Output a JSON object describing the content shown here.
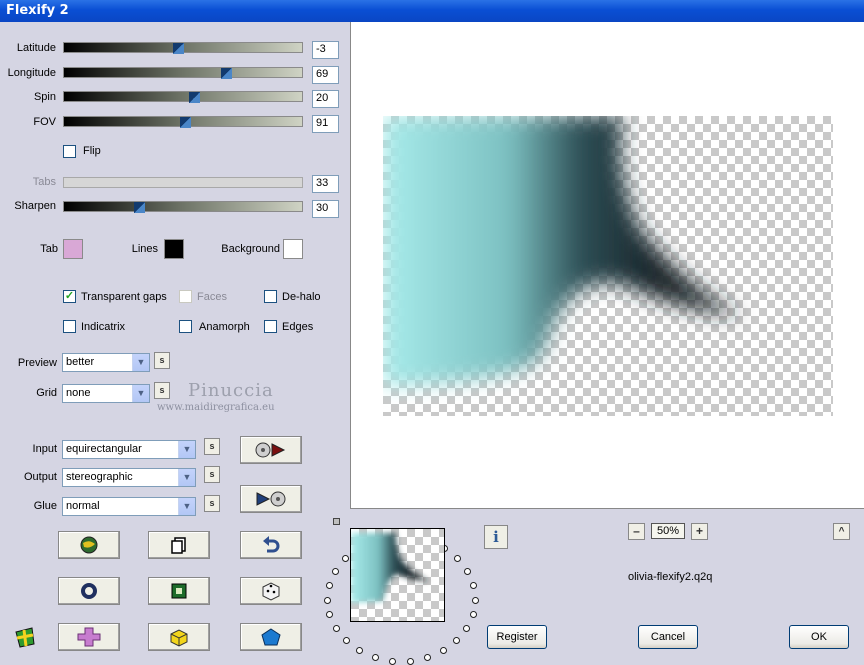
{
  "window": {
    "title": "Flexify 2"
  },
  "sliders": {
    "latitude": {
      "label": "Latitude",
      "value": "-3",
      "position": 0.48
    },
    "longitude": {
      "label": "Longitude",
      "value": "69",
      "position": 0.69
    },
    "spin": {
      "label": "Spin",
      "value": "20",
      "position": 0.55
    },
    "fov": {
      "label": "FOV",
      "value": "91",
      "position": 0.51
    },
    "tabs": {
      "label": "Tabs",
      "value": "33"
    },
    "sharpen": {
      "label": "Sharpen",
      "value": "30",
      "position": 0.31
    }
  },
  "flip": {
    "label": "Flip",
    "checked": false
  },
  "colors": {
    "tab": {
      "label": "Tab",
      "color": "#d9a8d6"
    },
    "lines": {
      "label": "Lines",
      "color": "#000000"
    },
    "background": {
      "label": "Background",
      "color": "#ffffff"
    }
  },
  "options": {
    "transparent_gaps": {
      "label": "Transparent gaps",
      "checked": true
    },
    "faces": {
      "label": "Faces",
      "checked": false
    },
    "dehalo": {
      "label": "De-halo",
      "checked": false
    },
    "indicatrix": {
      "label": "Indicatrix",
      "checked": false
    },
    "anamorph": {
      "label": "Anamorph",
      "checked": false
    },
    "edges": {
      "label": "Edges",
      "checked": false
    }
  },
  "dropdowns": {
    "preview": {
      "label": "Preview",
      "value": "better"
    },
    "grid": {
      "label": "Grid",
      "value": "none"
    },
    "input": {
      "label": "Input",
      "value": "equirectangular"
    },
    "output": {
      "label": "Output",
      "value": "stereographic"
    },
    "glue": {
      "label": "Glue",
      "value": "normal"
    }
  },
  "s_button_label": "s",
  "watermark": {
    "name": "Pinuccia",
    "url": "www.maidiregrafica.eu"
  },
  "zoom": {
    "minus": "–",
    "value": "50%",
    "plus": "+"
  },
  "scroll_up": "^",
  "info_label": "i",
  "filename": "olivia-flexify2.q2q",
  "buttons": {
    "register": "Register",
    "cancel": "Cancel",
    "ok": "OK"
  },
  "accent_colors": {
    "title_bar": "#0a4fd4",
    "preview_teal": "#9fe0de",
    "preview_dark": "#1a2a32"
  }
}
